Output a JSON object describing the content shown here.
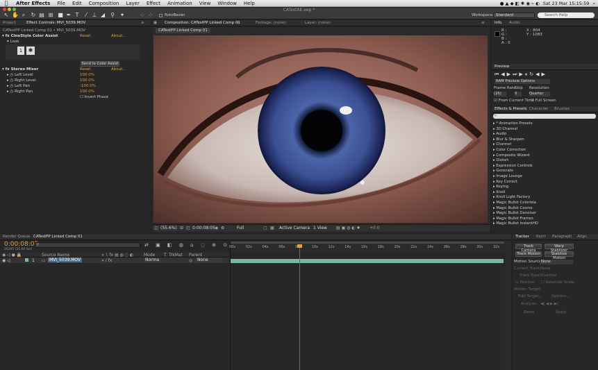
{
  "menubar": {
    "items": [
      "After Effects",
      "File",
      "Edit",
      "Composition",
      "Layer",
      "Effect",
      "Animation",
      "View",
      "Window",
      "Help"
    ],
    "clock": "Sat 23 Mar  15:15:59"
  },
  "toolbar": {
    "roto_label": "RotoBezier",
    "doc_title": "CATestAE.aep *",
    "workspace_label": "Workspace:",
    "workspace_value": "Standard",
    "search_placeholder": "Search Help"
  },
  "project_panel": {
    "tab_project": "Project",
    "tab_effect_controls": "Effect Controls: MVI_5039.MOV",
    "breadcrumb": "CATestPP Linked Comp 01 • MVI_5039.MOV",
    "effect1_name": "CineStyle Color Assist",
    "effect1_reset": "Reset",
    "effect1_about": "About...",
    "look_label": "Look",
    "send_button": "Send to Color Assist",
    "effect2_name": "Stereo Mixer",
    "effect2_reset": "Reset",
    "effect2_about": "About...",
    "params": [
      {
        "label": "Left Level",
        "value": "100.0%"
      },
      {
        "label": "Right Level",
        "value": "100.0%"
      },
      {
        "label": "Left Pan",
        "value": "-100.0%"
      },
      {
        "label": "Right Pan",
        "value": "100.0%"
      }
    ],
    "invert_phase": "Invert Phase"
  },
  "comp_panel": {
    "tab_comp": "Composition: CATestPP Linked Comp 01",
    "tab_footage": "Footage: (none)",
    "tab_layer": "Layer: (none)",
    "subtab": "CATestPP Linked Comp 01",
    "zoom": "(55.6%)",
    "timecode": "0:00:08:05",
    "resolution": "Full",
    "camera": "Active Camera",
    "views": "1 View",
    "exposure": "+0.0"
  },
  "info_panel": {
    "tab_info": "Info",
    "tab_audio": "Audio",
    "r": "R :",
    "g": "G :",
    "b": "B :",
    "a": "A : 0",
    "x": "X : 804",
    "y": "Y : 1083"
  },
  "preview_panel": {
    "tab": "Preview",
    "ram_options": "RAM Preview Options",
    "frame_rate_label": "Frame Rate",
    "skip_label": "Skip",
    "resolution_label": "Resolution",
    "frame_rate_value": "(25)",
    "skip_value": "0",
    "resolution_value": "Quarter",
    "from_current": "From Current Time",
    "full_screen": "Full Screen"
  },
  "effects_panel": {
    "tab_effects": "Effects & Presets",
    "tab_character": "Character",
    "tab_brushes": "Brushes",
    "search_placeholder": "",
    "items": [
      "* Animation Presets",
      "3D Channel",
      "Audio",
      "Blur & Sharpen",
      "Channel",
      "Color Correction",
      "Composite Wizard",
      "Distort",
      "Expression Controls",
      "Generate",
      "Image Lounge",
      "Key Correct",
      "Keying",
      "Knoll",
      "Knoll Light Factory",
      "Magic Bullet Colorista",
      "Magic Bullet Cosmo",
      "Magic Bullet Denoiser",
      "Magic Bullet Frames",
      "Magic Bullet InstantHD"
    ]
  },
  "timeline": {
    "tab_render": "Render Queue",
    "tab_comp": "CATestPP Linked Comp 01",
    "timecode": "0:00:08:05",
    "fps_info": "00205 (25.00 fps)",
    "search_placeholder": "P",
    "col_source": "Source Name",
    "col_mode": "Mode",
    "col_t": "T",
    "col_trkmat": "TrkMat",
    "col_parent": "Parent",
    "layer_index": "1",
    "layer_name": "MVI_5039.MOV",
    "layer_mode": "Norma",
    "layer_parent": "None",
    "ruler": [
      "00s",
      "02s",
      "04s",
      "06s",
      "08s",
      "10s",
      "12s",
      "14s",
      "16s",
      "18s",
      "20s",
      "22s",
      "24s",
      "26s",
      "28s",
      "30s",
      "32s"
    ],
    "playhead_fraction": 0.25
  },
  "tracker": {
    "tab_tracker": "Tracker",
    "tab_paint": "Paint",
    "tab_paragraph": "Paragraph",
    "tab_align": "Align",
    "track_camera": "Track Camera",
    "warp_stabilizer": "Warp Stabilizer",
    "track_motion": "Track Motion",
    "stabilize_motion": "Stabilize Motion",
    "motion_source_label": "Motion Source:",
    "motion_source_value": "None",
    "current_track_label": "Current Track:",
    "current_track_value": "None",
    "track_type_label": "Track Type:",
    "track_type_value": "Stabilize",
    "position": "Position",
    "rotation": "Rotation",
    "scale": "Scale",
    "motion_target": "Motion Target:",
    "edit_target": "Edit Target...",
    "options": "Options...",
    "analyze": "Analyze:",
    "reset": "Reset",
    "apply": "Apply"
  },
  "colors": {
    "accent": "#d59a35",
    "playhead": "#c8433f",
    "layerbar": "#7fb3a8"
  }
}
